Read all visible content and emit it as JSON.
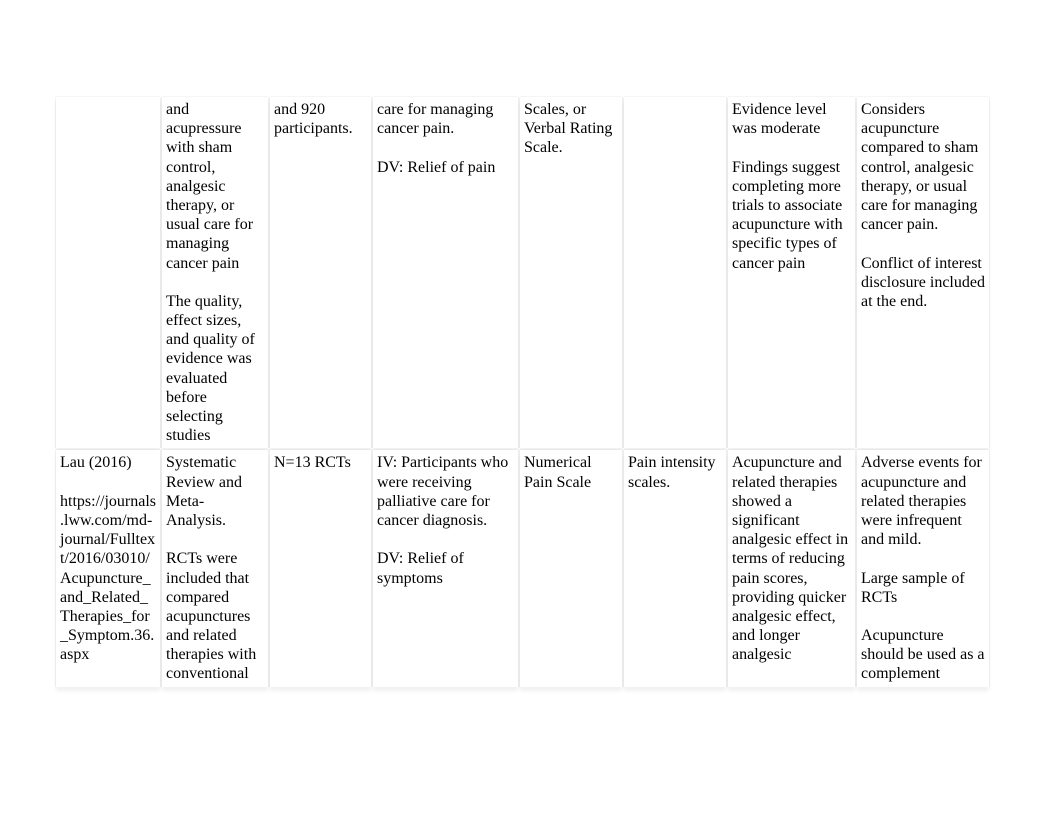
{
  "colors": {
    "bg": "#ffffff",
    "text": "#000000",
    "shadow": "rgba(0,0,0,0.06)"
  },
  "table": {
    "rows": [
      {
        "c1": "",
        "c2": "and acupressure with sham control, analgesic therapy, or usual care for managing cancer pain\n\nThe quality, effect sizes, and quality of evidence was evaluated before selecting studies",
        "c3": "and 920 participants.",
        "c4": "care for managing cancer pain.\n\nDV: Relief of pain",
        "c5": "Scales, or Verbal Rating Scale.",
        "c6": "",
        "c7": "Evidence level was moderate\n\nFindings suggest completing more trials to associate acupuncture with specific types of cancer pain",
        "c8": "Considers acupuncture compared to sham control, analgesic therapy, or usual care for managing cancer pain.\n\nConflict of interest disclosure included at the end."
      },
      {
        "c1": "Lau (2016)\n\nhttps://journals.lww.com/md-journal/Fulltext/2016/03010/Acupuncture_and_Related_Therapies_for_Symptom.36.aspx",
        "c2": "Systematic Review and Meta-Analysis.\n\nRCTs were included that compared acupunctures and related therapies with conventional",
        "c3": "N=13 RCTs",
        "c4": "IV: Participants who were receiving palliative care for cancer diagnosis.\n\nDV: Relief of symptoms",
        "c5": "Numerical Pain Scale",
        "c6": "Pain intensity scales.",
        "c7": "Acupuncture and related therapies showed a significant analgesic effect in terms of reducing pain scores, providing quicker analgesic effect, and longer analgesic",
        "c8": "Adverse events for acupuncture and related therapies were infrequent and mild.\n\nLarge sample of RCTs\n\nAcupuncture should be used as a complement"
      }
    ]
  }
}
